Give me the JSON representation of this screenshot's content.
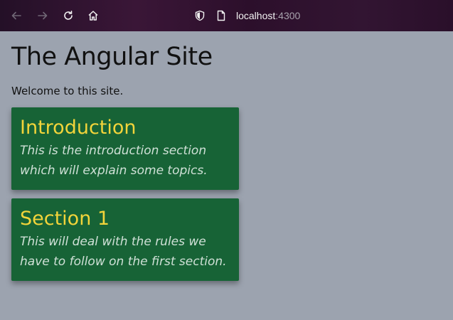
{
  "browser": {
    "url_host": "localhost",
    "url_port": ":4300",
    "icons": [
      "back-arrow-icon",
      "forward-arrow-icon",
      "reload-icon",
      "home-icon",
      "shield-icon",
      "page-icon"
    ]
  },
  "page": {
    "title": "The Angular Site",
    "welcome": "Welcome to this site.",
    "sections": [
      {
        "title": "Introduction",
        "body_line1": "This is the introduction section",
        "body_line2": "which will explain some topics."
      },
      {
        "title": "Section 1",
        "body_line1": "This will deal with the rules we",
        "body_line2": "have to follow on the first section."
      }
    ]
  },
  "colors": {
    "page_bg": "#9ca3af",
    "card_bg": "#176336",
    "card_title": "#f2d43a",
    "card_text": "#cfe0d6"
  }
}
